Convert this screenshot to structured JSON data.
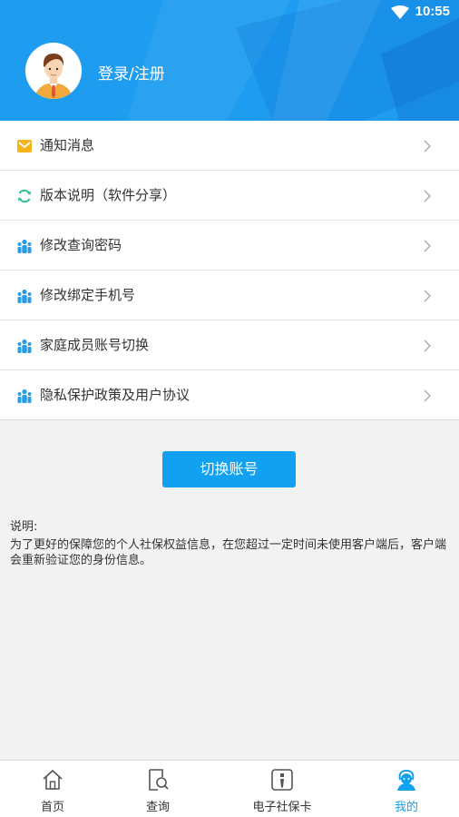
{
  "status_bar": {
    "time": "10:55"
  },
  "header": {
    "login_label": "登录/注册"
  },
  "menu": {
    "items": [
      {
        "label": "通知消息",
        "icon": "mail-icon"
      },
      {
        "label": "版本说明（软件分享）",
        "icon": "refresh-icon"
      },
      {
        "label": "修改查询密码",
        "icon": "users-icon"
      },
      {
        "label": "修改绑定手机号",
        "icon": "users-icon"
      },
      {
        "label": "家庭成员账号切换",
        "icon": "users-icon"
      },
      {
        "label": "隐私保护政策及用户协议",
        "icon": "users-icon"
      }
    ]
  },
  "switch_button": {
    "label": "切换账号"
  },
  "note": {
    "title": "说明:",
    "text": "为了更好的保障您的个人社保权益信息，在您超过一定时间未使用客户端后，客户端会重新验证您的身份信息。"
  },
  "tabbar": {
    "tabs": [
      {
        "label": "首页",
        "icon": "home-icon"
      },
      {
        "label": "查询",
        "icon": "search-doc-icon"
      },
      {
        "label": "电子社保卡",
        "icon": "card-icon"
      },
      {
        "label": "我的",
        "icon": "user-icon",
        "active": true
      }
    ]
  },
  "colors": {
    "primary": "#12a0f0",
    "header": "#1e9df0",
    "background": "#f2f2f2"
  }
}
